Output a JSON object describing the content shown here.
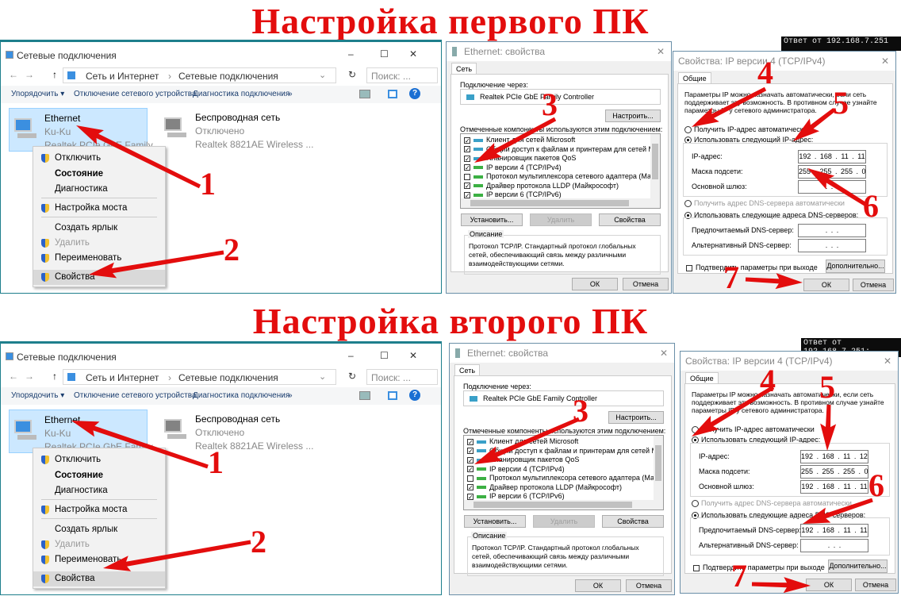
{
  "titles": [
    "Настройка первого ПК",
    "Настройка второго ПК"
  ],
  "explorer": {
    "window_title": "Сетевые подключения",
    "window_controls": {
      "minimize": "–",
      "maximize": "☐",
      "close": "✕"
    },
    "nav": {
      "back": "←",
      "forward": "→",
      "up": "↑",
      "refresh": "↻"
    },
    "breadcrumb": [
      "Сеть и Интернет",
      "Сетевые подключения"
    ],
    "breadcrumb_sep": "›",
    "search_placeholder": "Поиск: ...",
    "toolbar": [
      "Упорядочить ▾",
      "Отключение сетевого устройства",
      "Диагностика подключения",
      "»"
    ],
    "help": "?",
    "connections": [
      {
        "name": "Ethernet",
        "status": "Ku-Ku",
        "device": "Realtek PCIe GbE Family",
        "selected": true
      },
      {
        "name": "Беспроводная сеть",
        "status": "Отключено",
        "device": "Realtek 8821AE Wireless ...",
        "selected": false
      }
    ],
    "context_menu": [
      {
        "label": "Отключить",
        "shield": true
      },
      {
        "label": "Состояние",
        "bold": true
      },
      {
        "label": "Диагностика"
      },
      {
        "label": "Настройка моста",
        "shield": true
      },
      {
        "label": "Создать ярлык"
      },
      {
        "label": "Удалить",
        "shield": true,
        "disabled": true
      },
      {
        "label": "Переименовать",
        "shield": true
      },
      {
        "label": "Свойства",
        "shield": true,
        "highlighted": true
      }
    ]
  },
  "eth_props": {
    "title": "Ethernet: свойства",
    "close": "✕",
    "tab": "Сеть",
    "connect_via_label": "Подключение через:",
    "adapter": "Realtek PCIe GbE Family Controller",
    "configure": "Настроить...",
    "components_label": "Отмеченные компоненты используются этим подключением:",
    "components": [
      {
        "label": "Клиент для сетей Microsoft",
        "checked": true
      },
      {
        "label": "Общий доступ к файлам и принтерам для сетей Microsoft",
        "checked": true
      },
      {
        "label": "Планировщик пакетов QoS",
        "checked": true
      },
      {
        "label": "IP версии 4 (TCP/IPv4)",
        "checked": true
      },
      {
        "label": "Протокол мультиплексора сетевого адаптера (Майкрософт)",
        "checked": false
      },
      {
        "label": "Драйвер протокола LLDP (Майкрософт)",
        "checked": true
      },
      {
        "label": "IP версии 6 (TCP/IPv6)",
        "checked": true
      }
    ],
    "install": "Установить...",
    "remove": "Удалить",
    "properties": "Свойства",
    "description_label": "Описание",
    "description": "Протокол TCP/IP. Стандартный протокол глобальных сетей, обеспечивающий связь между различными взаимодействующими сетями.",
    "ok": "ОК",
    "cancel": "Отмена"
  },
  "ipv4": {
    "title": "Свойства: IP версии 4 (TCP/IPv4)",
    "close": "✕",
    "tab": "Общие",
    "intro": "Параметры IP можно назначать автоматически, если сеть поддерживает эту возможность. В противном случае узнайте параметры IP у сетевого администратора.",
    "auto_ip": "Получить IP-адрес автоматически",
    "manual_ip": "Использовать следующий IP-адрес:",
    "ip_label": "IP-адрес:",
    "mask_label": "Маска подсети:",
    "gateway_label": "Основной шлюз:",
    "auto_dns": "Получить адрес DNS-сервера автоматически",
    "manual_dns": "Использовать следующие адреса DNS-серверов:",
    "pref_dns_label": "Предпочитаемый DNS-сервер:",
    "alt_dns_label": "Альтернативный DNS-сервер:",
    "validate": "Подтвердить параметры при выходе",
    "advanced": "Дополнительно...",
    "ok": "ОК",
    "cancel": "Отмена"
  },
  "pcs": [
    {
      "cmd": [
        "Ответ от 192.168.7.251"
      ],
      "ip": "192 . 168 . 11 . 11",
      "mask": "255 . 255 . 255 . 0",
      "gateway": ".     .     .",
      "pref_dns": ".     .     .",
      "alt_dns": ".     .     .",
      "steps": [
        "1",
        "2",
        "3",
        "4",
        "5",
        "6",
        "7"
      ]
    },
    {
      "cmd": [
        "Ответ от 192.168.7.251:",
        "Ответ от 192.168.7.251:"
      ],
      "ip": "192 . 168 . 11 . 12",
      "mask": "255 . 255 . 255 . 0",
      "gateway": "192 . 168 . 11 . 11",
      "pref_dns": "192 . 168 . 11 . 11",
      "alt_dns": ".     .     .",
      "steps": [
        "1",
        "2",
        "3",
        "4",
        "5",
        "6",
        "7"
      ]
    }
  ],
  "colors": {
    "annotation": "#e30d0d",
    "selection": "#cce8ff",
    "accent": "#1e7f8c"
  }
}
